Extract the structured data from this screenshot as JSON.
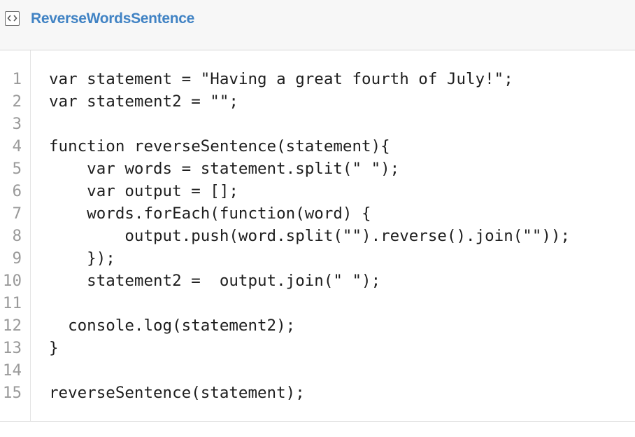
{
  "file": {
    "icon": "code-file-icon",
    "title": "ReverseWordsSentence"
  },
  "colors": {
    "title": "#4183c4",
    "header_bg": "#f7f7f7",
    "line_number": "#9a9a9a",
    "code_text": "#1e1e1e"
  },
  "code": {
    "lines": [
      {
        "no": "1",
        "text": "var statement = \"Having a great fourth of July!\";"
      },
      {
        "no": "2",
        "text": "var statement2 = \"\";"
      },
      {
        "no": "3",
        "text": ""
      },
      {
        "no": "4",
        "text": "function reverseSentence(statement){"
      },
      {
        "no": "5",
        "text": "    var words = statement.split(\" \");"
      },
      {
        "no": "6",
        "text": "    var output = [];"
      },
      {
        "no": "7",
        "text": "    words.forEach(function(word) {"
      },
      {
        "no": "8",
        "text": "        output.push(word.split(\"\").reverse().join(\"\"));"
      },
      {
        "no": "9",
        "text": "    });"
      },
      {
        "no": "10",
        "text": "    statement2 =  output.join(\" \");"
      },
      {
        "no": "11",
        "text": ""
      },
      {
        "no": "12",
        "text": "  console.log(statement2);"
      },
      {
        "no": "13",
        "text": "}"
      },
      {
        "no": "14",
        "text": ""
      },
      {
        "no": "15",
        "text": "reverseSentence(statement);"
      }
    ]
  }
}
